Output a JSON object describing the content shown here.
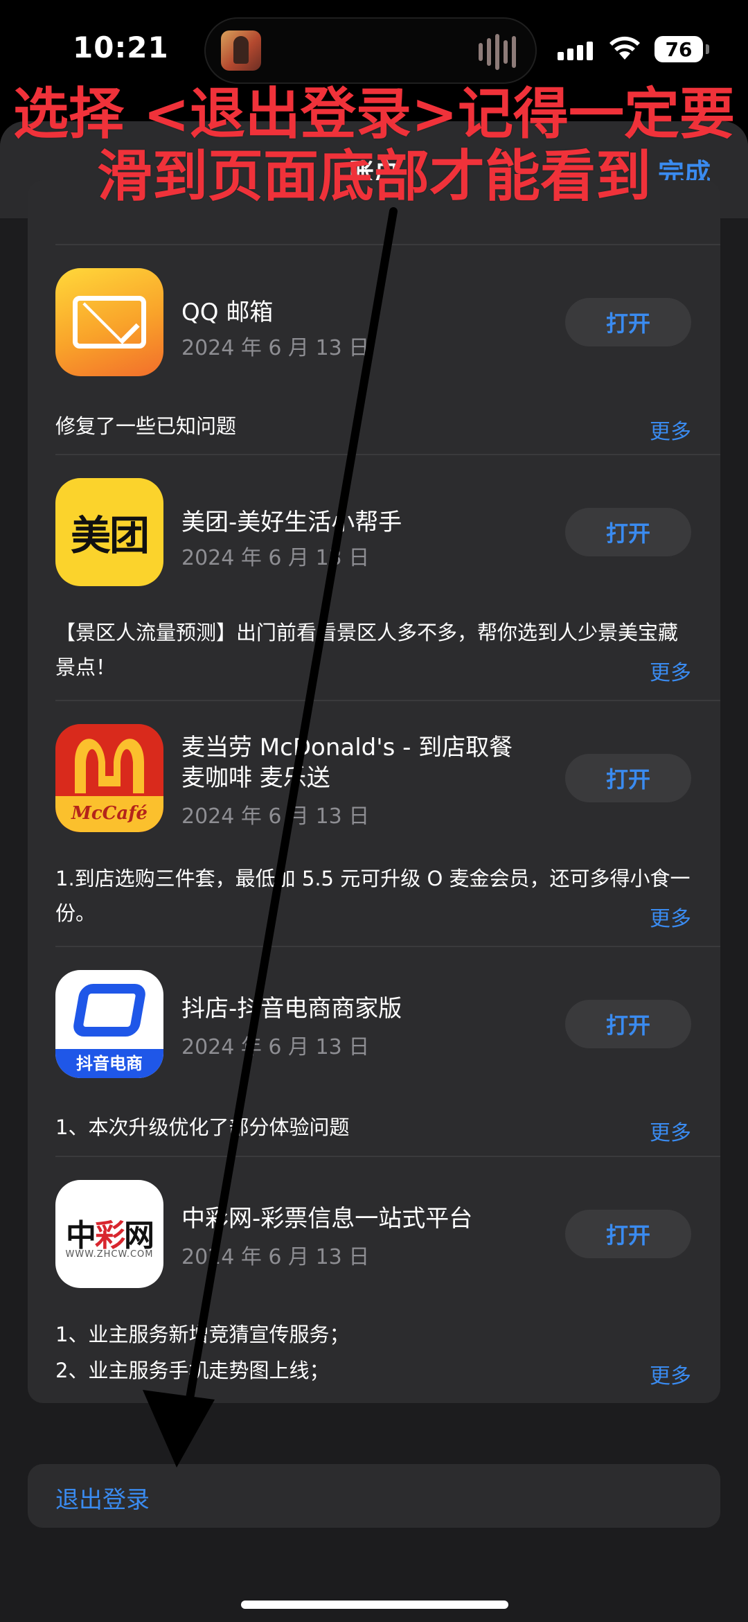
{
  "status_bar": {
    "time": "10:21",
    "battery": "76"
  },
  "sheet": {
    "title": "账户",
    "done_label": "完成"
  },
  "apps": [
    {
      "name": "QQ 邮箱",
      "date": "2024 年 6 月 13 日",
      "open_label": "打开",
      "notes": "修复了一些已知问题",
      "more_label": "更多",
      "icon": "mail-envelope-icon"
    },
    {
      "name": "美团-美好生活小帮手",
      "date": "2024 年 6 月 13 日",
      "open_label": "打开",
      "notes": "【景区人流量预测】出门前看看景区人多不多，帮你选到人少景美宝藏景点！",
      "more_label": "更多",
      "icon_text": "美团",
      "icon": "meituan-logo-icon"
    },
    {
      "name": "麦当劳 McDonald's - 到店取餐 麦咖啡 麦乐送",
      "date": "2024 年 6 月 13 日",
      "open_label": "打开",
      "notes": "1.到店选购三件套，最低加 5.5 元可升级 O 麦金会员，还可多得小食一份。",
      "more_label": "更多",
      "icon_text": "McCafé",
      "icon": "mcdonalds-logo-icon"
    },
    {
      "name": "抖店-抖音电商商家版",
      "date": "2024 年 6 月 13 日",
      "open_label": "打开",
      "notes": "1、本次升级优化了部分体验问题",
      "more_label": "更多",
      "icon_text": "抖音电商",
      "icon": "doudian-logo-icon"
    },
    {
      "name": "中彩网-彩票信息一站式平台",
      "date": "2024 年 6 月 13 日",
      "open_label": "打开",
      "notes_line1": "1、业主服务新增竞猜宣传服务；",
      "notes_line2": "2、业主服务手机走势图上线；",
      "more_label": "更多",
      "icon_text_a": "中",
      "icon_text_b": "彩",
      "icon_text_c": "网",
      "icon_url": "WWW.ZHCW.COM",
      "icon": "zhcw-logo-icon"
    }
  ],
  "signout_label": "退出登录",
  "annotation": {
    "line1": "选择 <退出登录>记得一定要",
    "line2": "滑到页面底部才能看到"
  },
  "colors": {
    "accent": "#3a8bf0",
    "annotation": "#f0323a",
    "card": "#2c2c2e"
  }
}
